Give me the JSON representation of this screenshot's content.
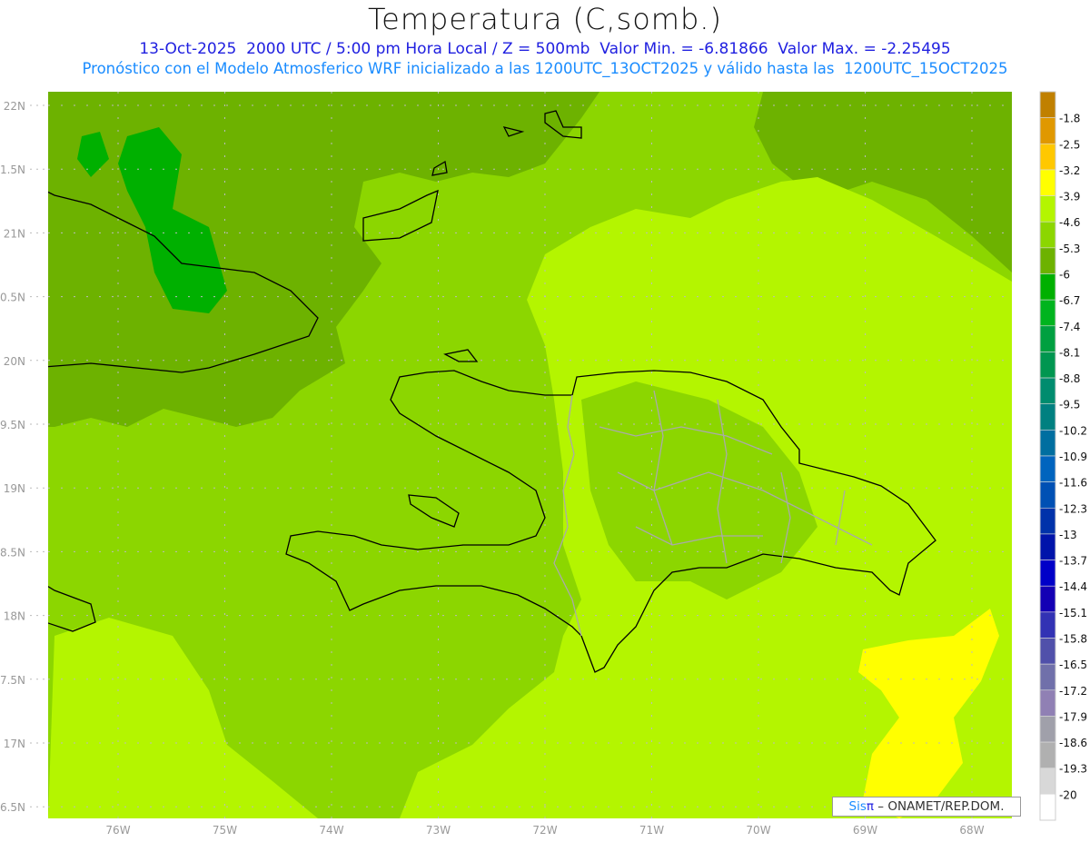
{
  "header": {
    "title": "Temperatura (C,somb.)",
    "line1": "13-Oct-2025  2000 UTC / 5:00 pm Hora Local / Z = 500mb  Valor Min. = -6.81866  Valor Max. = -2.25495",
    "line2": "Pronóstico con el Modelo Atmosferico WRF inicializado a las 1200UTC_13OCT2025 y válido hasta las  1200UTC_15OCT2025"
  },
  "axes": {
    "lat_labels": [
      "22N",
      "1.5N",
      "21N",
      "0.5N",
      "20N",
      "9.5N",
      "19N",
      "8.5N",
      "18N",
      "7.5N",
      "17N",
      "6.5N"
    ],
    "lon_labels": [
      "76W",
      "75W",
      "74W",
      "73W",
      "72W",
      "71W",
      "70W",
      "69W",
      "68W"
    ]
  },
  "colorbar": {
    "labels": [
      "-1.8",
      "-2.5",
      "-3.2",
      "-3.9",
      "-4.6",
      "-5.3",
      "-6",
      "-6.7",
      "-7.4",
      "-8.1",
      "-8.8",
      "-9.5",
      "-10.2",
      "-10.9",
      "-11.6",
      "-12.3",
      "-13",
      "-13.7",
      "-14.4",
      "-15.1",
      "-15.8",
      "-16.5",
      "-17.2",
      "-17.9",
      "-18.6",
      "-19.3",
      "-20"
    ],
    "colors": [
      "#c08000",
      "#e09800",
      "#ffc800",
      "#ffff00",
      "#b4f500",
      "#8cd600",
      "#6db200",
      "#00b000",
      "#00b41e",
      "#00a040",
      "#009650",
      "#008c6e",
      "#008080",
      "#006ea0",
      "#0064be",
      "#0050b4",
      "#0032aa",
      "#0014aa",
      "#0000c8",
      "#1400b4",
      "#3232b4",
      "#5050aa",
      "#7070aa",
      "#9080b4",
      "#a0a0aa",
      "#b0b0b0",
      "#d8d8d8",
      "#ffffff"
    ]
  },
  "credit": {
    "sis": "Sis",
    "pi": "π",
    "org": " – ONAMET/REP.DOM."
  }
}
